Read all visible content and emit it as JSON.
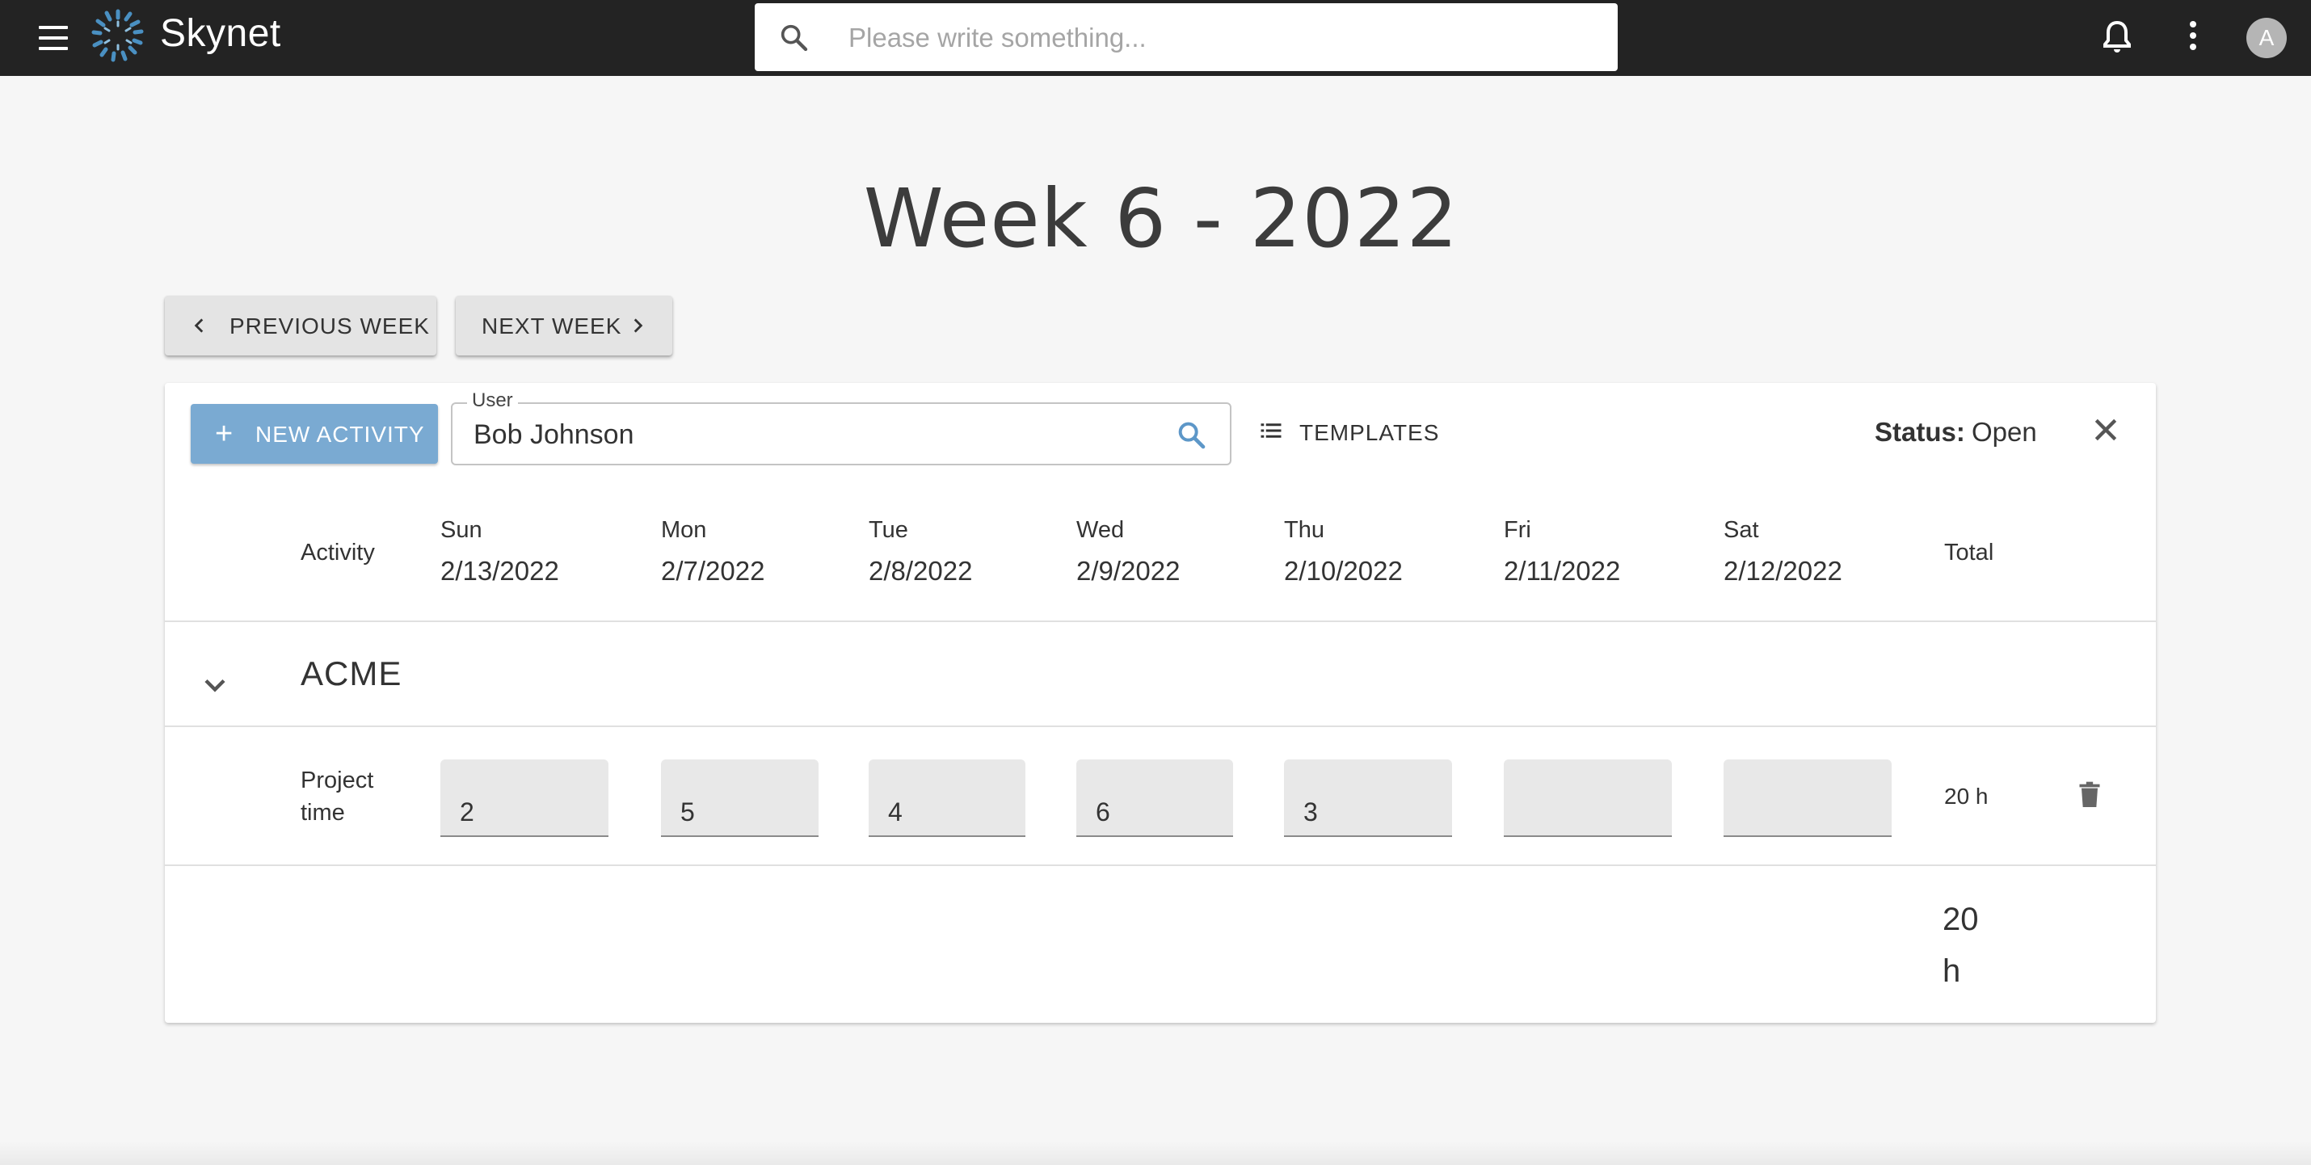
{
  "app": {
    "title": "Skynet",
    "avatar_initial": "A"
  },
  "search": {
    "placeholder": "Please write something..."
  },
  "page": {
    "week_title": "Week 6 - 2022"
  },
  "nav": {
    "previous_label": "PREVIOUS WEEK",
    "next_label": "NEXT WEEK"
  },
  "toolbar": {
    "new_activity_label": "NEW ACTIVITY",
    "user_legend": "User",
    "user_value": "Bob Johnson",
    "templates_label": "TEMPLATES",
    "status_label": "Status:",
    "status_value": "Open"
  },
  "table": {
    "activity_header": "Activity",
    "total_header": "Total",
    "days": [
      {
        "name": "Sun",
        "date": "2/13/2022"
      },
      {
        "name": "Mon",
        "date": "2/7/2022"
      },
      {
        "name": "Tue",
        "date": "2/8/2022"
      },
      {
        "name": "Wed",
        "date": "2/9/2022"
      },
      {
        "name": "Thu",
        "date": "2/10/2022"
      },
      {
        "name": "Fri",
        "date": "2/11/2022"
      },
      {
        "name": "Sat",
        "date": "2/12/2022"
      }
    ],
    "group": {
      "name": "ACME",
      "rows": [
        {
          "activity": "Project time",
          "hours": [
            "2",
            "5",
            "4",
            "6",
            "3",
            "",
            ""
          ],
          "total": "20 h"
        }
      ]
    },
    "grand_total": "20 h"
  },
  "colors": {
    "appbar": "#232323",
    "primary_button": "#7aaad2",
    "accent_icon": "#5d97c8",
    "background": "#f6f6f6"
  },
  "icons": {
    "menu": "hamburger-icon",
    "logo": "skynet-logo",
    "search": "search-icon",
    "notifications": "bell-icon",
    "more": "more-vert-icon",
    "prev": "chevron-left-icon",
    "next": "chevron-right-icon",
    "add": "plus-icon",
    "templates": "list-icon",
    "close": "close-icon",
    "expand": "chevron-down-icon",
    "delete": "trash-icon"
  }
}
